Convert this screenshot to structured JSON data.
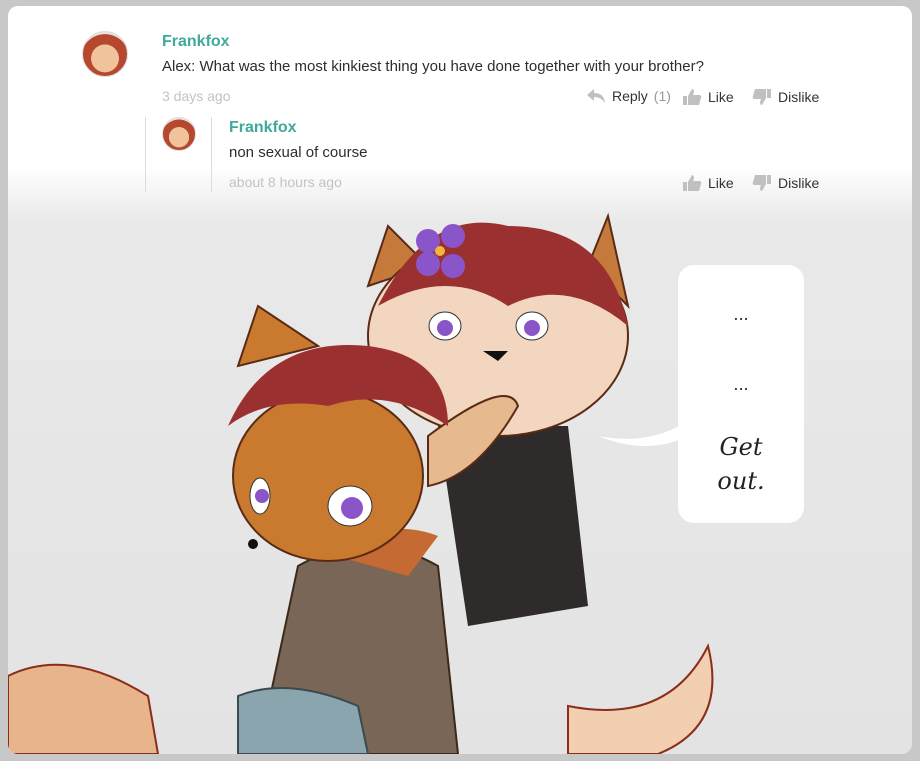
{
  "comments": [
    {
      "author": "Frankfox",
      "text": "Alex: What was the most kinkiest thing you have done together with your brother?",
      "time": "3 days ago",
      "reply_label": "Reply",
      "reply_count": "(1)",
      "like_label": "Like",
      "dislike_label": "Dislike"
    },
    {
      "author": "Frankfox",
      "text": "non sexual of course",
      "time": "about 8 hours ago",
      "like_label": "Like",
      "dislike_label": "Dislike"
    }
  ],
  "speech_bubble": {
    "line1": "...",
    "line2": "...",
    "line3": "Get",
    "line4": "out."
  },
  "colors": {
    "author": "#3fa99b",
    "fur": "#c97a2e",
    "hair": "#9b3030",
    "flower": "#8a55c8"
  }
}
